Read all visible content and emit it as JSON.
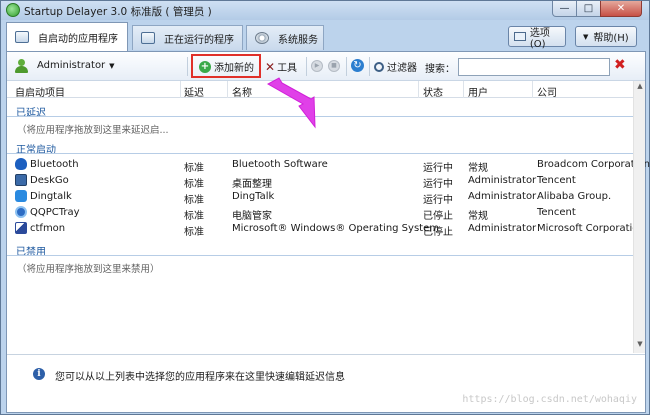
{
  "window": {
    "title": "Startup Delayer 3.0 标准版 ( 管理员 )",
    "minimize": "—",
    "maximize": "□",
    "close": "✕"
  },
  "tabs": [
    {
      "label": "自启动的应用程序",
      "active": true
    },
    {
      "label": "正在运行的程序",
      "active": false
    },
    {
      "label": "系统服务",
      "active": false
    }
  ],
  "options_label": "选项(O)",
  "help_label": "帮助(H)",
  "toolbar": {
    "user": "Administrator",
    "add_new": "添加新的",
    "tools": "工具",
    "filter": "过滤器",
    "search_label": "搜索：",
    "search_value": "",
    "search_placeholder": ""
  },
  "columns": [
    "自启动项目",
    "延迟",
    "名称",
    "状态",
    "用户",
    "公司"
  ],
  "groups": {
    "delayed": {
      "label": "已延迟",
      "placeholder": "（将应用程序拖放到这里来延迟启..."
    },
    "normal": {
      "label": "正常启动"
    },
    "disabled": {
      "label": "已禁用",
      "placeholder": "（将应用程序拖放到这里来禁用）"
    }
  },
  "rows": [
    {
      "item": "Bluetooth",
      "delay": "标准",
      "name": "Bluetooth Software",
      "status": "运行中",
      "user": "常规",
      "company": "Broadcom Corporation",
      "icon": "bluetooth-icon"
    },
    {
      "item": "DeskGo",
      "delay": "标准",
      "name": "桌面整理",
      "status": "运行中",
      "user": "Administrator",
      "company": "Tencent",
      "icon": "deskgo-icon"
    },
    {
      "item": "Dingtalk",
      "delay": "标准",
      "name": "DingTalk",
      "status": "运行中",
      "user": "Administrator",
      "company": "Alibaba Group.",
      "icon": "dingtalk-icon"
    },
    {
      "item": "QQPCTray",
      "delay": "标准",
      "name": "电脑管家",
      "status": "已停止",
      "user": "常规",
      "company": "Tencent",
      "icon": "qqpctray-icon"
    },
    {
      "item": "ctfmon",
      "delay": "标准",
      "name": "Microsoft® Windows® Operating System",
      "status": "已停止",
      "user": "Administrator",
      "company": "Microsoft Corporation",
      "icon": "ctfmon-icon"
    }
  ],
  "info": {
    "text": "您可以从以上列表中选择您的应用程序来在这里快速编辑延迟信息"
  },
  "watermark": "https://blog.csdn.net/wohaqiy"
}
